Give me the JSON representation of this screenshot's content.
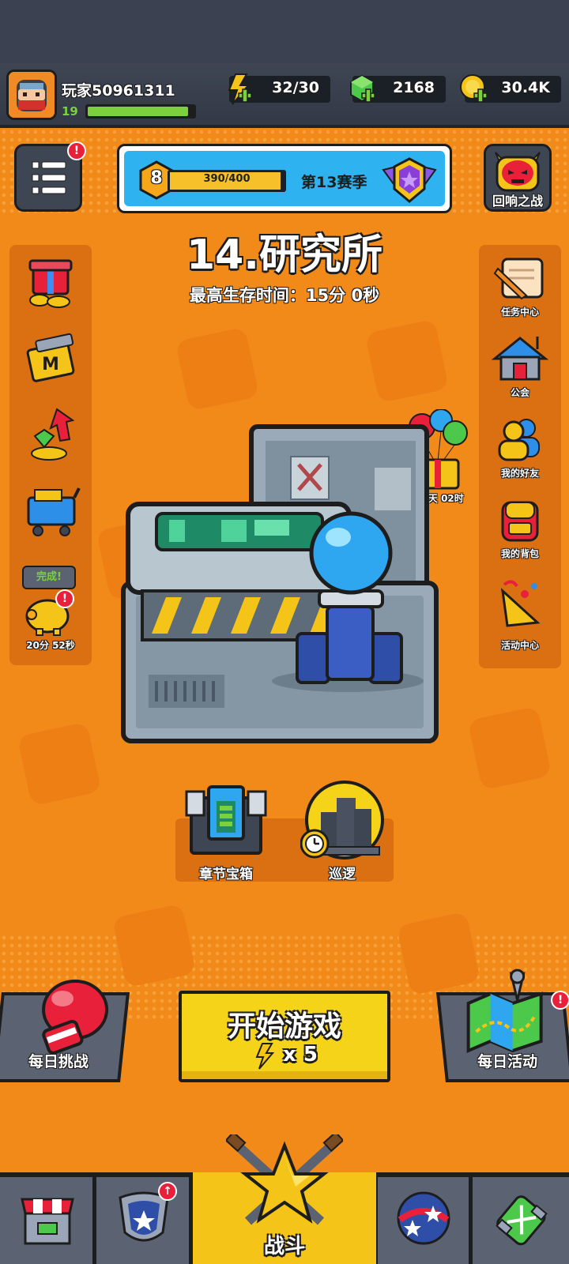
{
  "header": {
    "player_name": "玩家50961311",
    "level": "19",
    "xp_fraction": 0.95,
    "energy": "32/30",
    "gems": "2168",
    "coins": "30.4K"
  },
  "season": {
    "level": "8",
    "progress_text": "390/400",
    "progress_fraction": 0.975,
    "name": "第13赛季"
  },
  "menu_badge": "!",
  "echo_battle_label": "回响之战",
  "chapter": {
    "title": "14.研究所",
    "best_time": "最高生存时间：15分 0秒"
  },
  "left_side": {
    "piggy_bubble": "完成!",
    "piggy_timer": "20分 52秒",
    "piggy_badge": "!"
  },
  "right_side": {
    "gift_timer": "02天 02时",
    "items": [
      {
        "label": "任务中心",
        "icon": "scroll-quill-icon"
      },
      {
        "label": "公会",
        "icon": "guild-house-icon"
      },
      {
        "label": "我的好友",
        "icon": "friends-icon"
      },
      {
        "label": "我的背包",
        "icon": "backpack-icon"
      },
      {
        "label": "活动中心",
        "icon": "party-horn-icon"
      }
    ]
  },
  "lower": {
    "chest_label": "章节宝箱",
    "patrol_label": "巡逻"
  },
  "start": {
    "label": "开始游戏",
    "cost": "x 5"
  },
  "daily_challenge_label": "每日挑战",
  "daily_event_label": "每日活动",
  "daily_event_badge": "!",
  "nav": {
    "active_label": "战斗",
    "tabs": [
      "shop-icon",
      "talent-badge-icon",
      "battle-icon",
      "gem-ball-icon",
      "dna-icon"
    ],
    "talent_badge": "↑"
  },
  "colors": {
    "background_orange": "#f28a1a",
    "start_yellow": "#f5d318",
    "header_dark": "#3e4553",
    "badge_red": "#e8203a",
    "xp_green": "#7bd13d"
  }
}
